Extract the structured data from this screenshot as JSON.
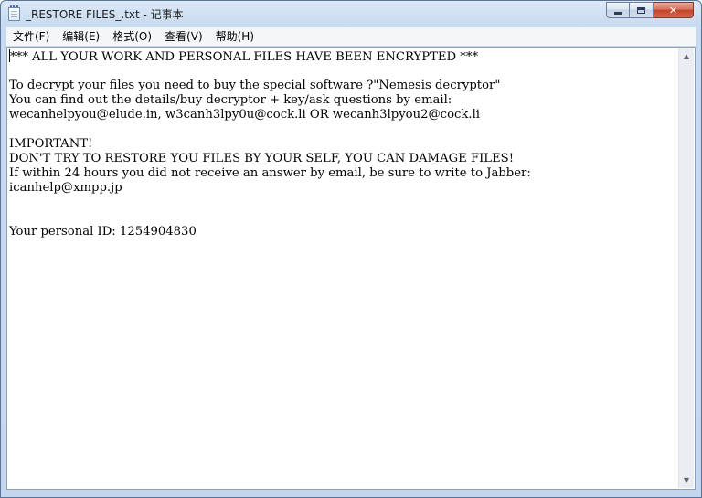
{
  "window": {
    "title": "_RESTORE FILES_.txt - 记事本",
    "icon": "notepad-icon"
  },
  "menu": [
    "文件(F)",
    "编辑(E)",
    "格式(O)",
    "查看(V)",
    "帮助(H)"
  ],
  "document": {
    "lines": [
      "*** ALL YOUR WORK AND PERSONAL FILES HAVE BEEN ENCRYPTED ***",
      "",
      "To decrypt your files you need to buy the special software ?\"Nemesis decryptor\"",
      "You can find out the details/buy decryptor + key/ask questions by email:",
      "wecanhelpyou@elude.in, w3canh3lpy0u@cock.li OR wecanh3lpyou2@cock.li",
      "",
      "IMPORTANT!",
      "DON'T TRY TO RESTORE YOU FILES BY YOUR SELF, YOU CAN DAMAGE FILES!",
      "If within 24 hours you did not receive an answer by email, be sure to write to Jabber:",
      "icanhelp@xmpp.jp",
      "",
      "",
      "Your personal ID: 1254904830"
    ]
  }
}
